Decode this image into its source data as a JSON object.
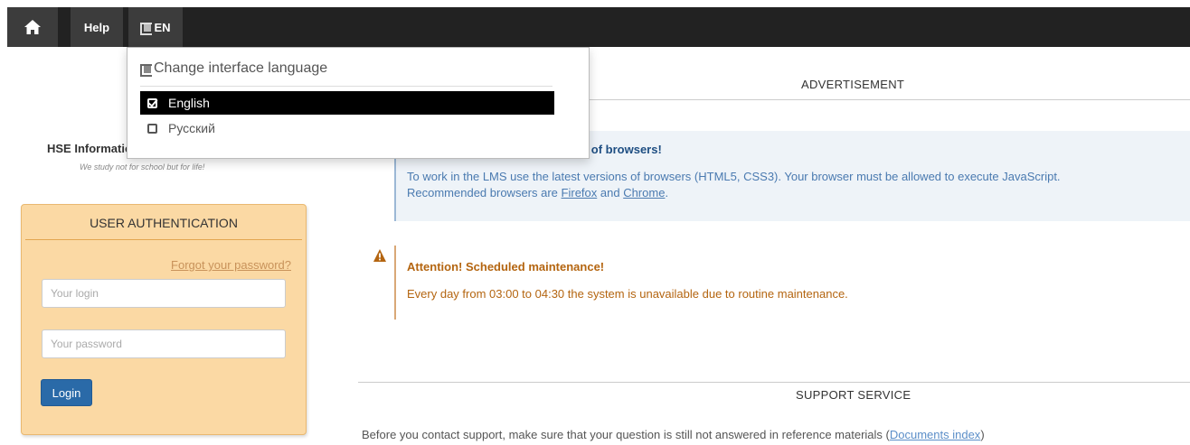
{
  "nav": {
    "help_label": "Help",
    "lang_label": "EN"
  },
  "lang_menu": {
    "title": "Change interface language",
    "options": [
      {
        "label": "English",
        "checked": true
      },
      {
        "label": "Русский",
        "checked": false
      }
    ]
  },
  "site": {
    "name": "HSE Information Space",
    "motto": "We study not for school but for life!"
  },
  "auth": {
    "title": "USER AUTHENTICATION",
    "forgot_label": "Forgot your password?",
    "login_placeholder": "Your login",
    "password_placeholder": "Your password",
    "login_button": "Login"
  },
  "advertisement": {
    "heading": "ADVERTISEMENT"
  },
  "browser_notice": {
    "title_visible": "ns of browsers!",
    "line1": "To work in the LMS use the latest versions of browsers (HTML5, CSS3). Your browser must be allowed to execute JavaScript.",
    "line2_prefix": "Recommended browsers are ",
    "firefox": "Firefox",
    "and": " and ",
    "chrome": "Chrome",
    "line2_suffix": "."
  },
  "maintenance": {
    "title": "Attention! Scheduled maintenance!",
    "text": "Every day from 03:00 to 04:30 the system is unavailable due to routine maintenance."
  },
  "support": {
    "heading": "SUPPORT SERVICE",
    "text_prefix": "Before you contact support, make sure that your question is still not answered in reference materials (",
    "link": "Documents index",
    "text_suffix": ")"
  },
  "colors": {
    "topbar": "#222222",
    "auth_bg": "#fbd9a4",
    "login_button": "#2a6aa8",
    "info_title": "#1e4e82",
    "warning": "#b46510"
  },
  "icons": [
    "home-icon",
    "language-flag-icon",
    "checkbox-checked-icon",
    "checkbox-empty-icon",
    "warning-icon"
  ]
}
